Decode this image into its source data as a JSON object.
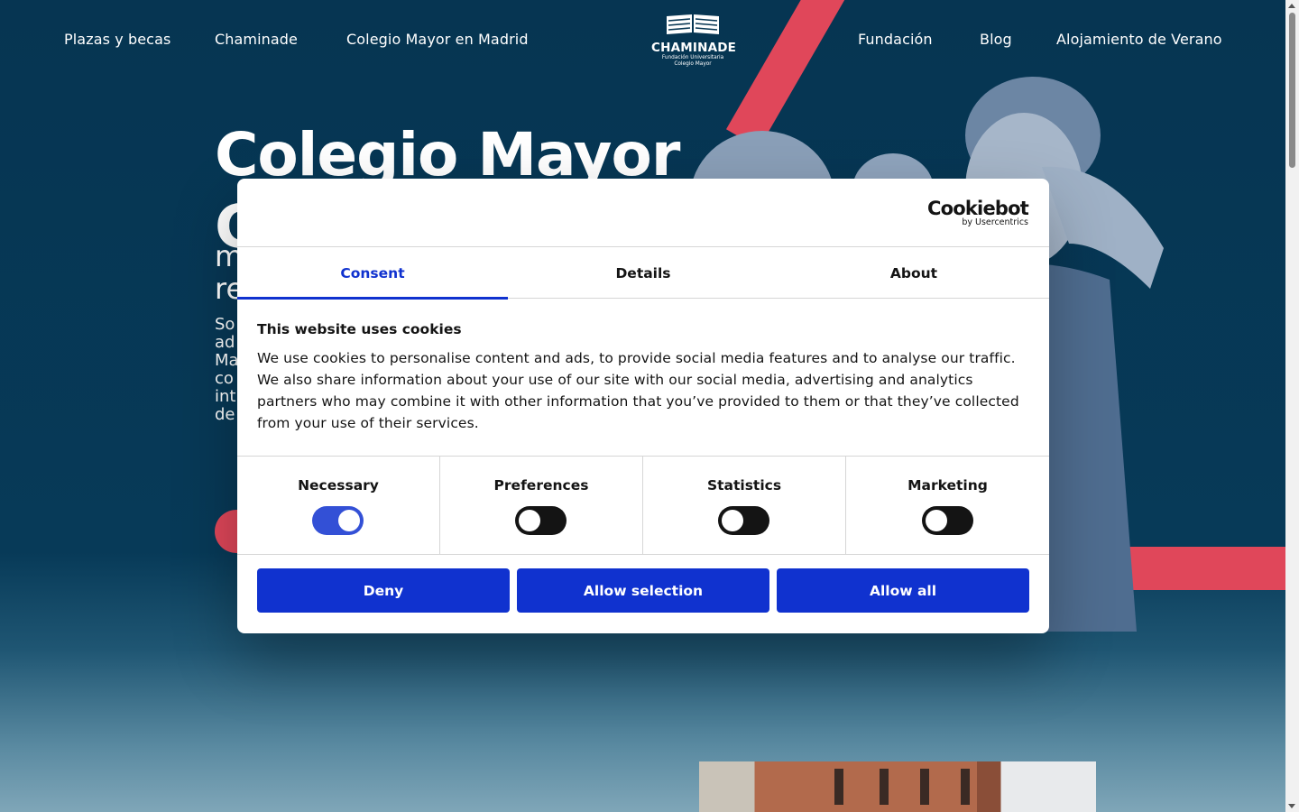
{
  "nav": {
    "left": [
      "Plazas y becas",
      "Chaminade",
      "Colegio Mayor en Madrid"
    ],
    "right": [
      "Fundación",
      "Blog",
      "Alojamiento de Verano"
    ]
  },
  "logo": {
    "brand": "CHAMINADE",
    "line1": "Fundación Universitaria",
    "line2": "Colegio Mayor"
  },
  "hero": {
    "title_line1": "Colegio Mayor",
    "title_line2": "C",
    "sub_line1": "m",
    "sub_line2": "re",
    "body": [
      "So",
      "ad",
      "Ma",
      "co",
      "int",
      "de"
    ]
  },
  "colors": {
    "accent": "#e0475a",
    "navy": "#063552",
    "cookiebot_blue": "#1032cf"
  },
  "dialog": {
    "logo_name": "Cookiebot",
    "logo_by": "by Usercentrics",
    "tabs": [
      "Consent",
      "Details",
      "About"
    ],
    "active_tab": "Consent",
    "title": "This website uses cookies",
    "text": "We use cookies to personalise content and ads, to provide social media features and to analyse our traffic. We also share information about your use of our site with our social media, advertising and analytics partners who may combine it with other information that you’ve provided to them or that they’ve collected from your use of their services.",
    "categories": [
      {
        "label": "Necessary",
        "enabled": true
      },
      {
        "label": "Preferences",
        "enabled": false
      },
      {
        "label": "Statistics",
        "enabled": false
      },
      {
        "label": "Marketing",
        "enabled": false
      }
    ],
    "buttons": {
      "deny": "Deny",
      "allow_selection": "Allow selection",
      "allow_all": "Allow all"
    }
  }
}
